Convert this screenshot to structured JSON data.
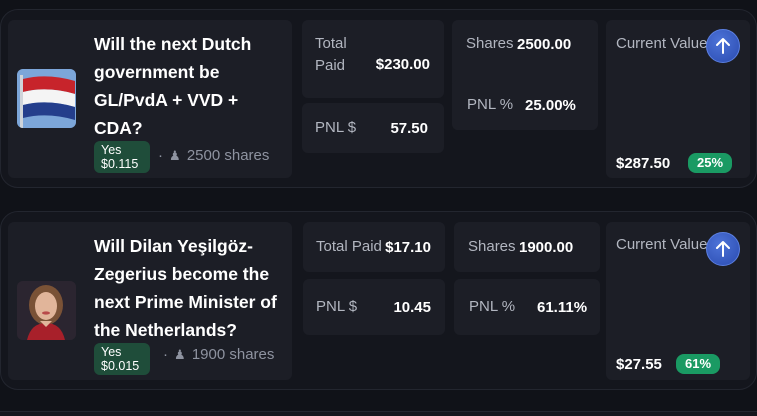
{
  "positions": [
    {
      "question": "Will the next Dutch government be GL/PvdA + VVD + CDA?",
      "thumbnail_icon": "netherlands-flag",
      "outcome_label": "Yes",
      "outcome_price": "$0.115",
      "separator": "·",
      "shares_text": "2500 shares",
      "total_paid_label": "Total Paid",
      "total_paid_value": "$230.00",
      "shares_label": "Shares",
      "shares_value": "2500.00",
      "pnl_label": "PNL $",
      "pnl_value": "57.50",
      "pnl_pct_label": "PNL %",
      "pnl_pct_value": "25.00%",
      "current_value_label": "Current Value",
      "current_value": "$287.50",
      "change_pct": "25%"
    },
    {
      "question": "Will Dilan Yeşilgöz-Zegerius become the next Prime Minister of the Netherlands?",
      "thumbnail_icon": "person-portrait",
      "outcome_label": "Yes",
      "outcome_price": "$0.015",
      "separator": "·",
      "shares_text": "1900 shares",
      "total_paid_label": "Total Paid",
      "total_paid_value": "$17.10",
      "shares_label": "Shares",
      "shares_value": "1900.00",
      "pnl_label": "PNL $",
      "pnl_value": "10.45",
      "pnl_pct_label": "PNL %",
      "pnl_pct_value": "61.11%",
      "current_value_label": "Current Value",
      "current_value": "$27.55",
      "change_pct": "61%"
    }
  ],
  "colors": {
    "background": "#101218",
    "card": "#14161d",
    "tile": "#1c1e26",
    "outcome_badge": "#1f4d3a",
    "change_badge": "#1a9a63",
    "action_button": "#3a5fc9"
  }
}
